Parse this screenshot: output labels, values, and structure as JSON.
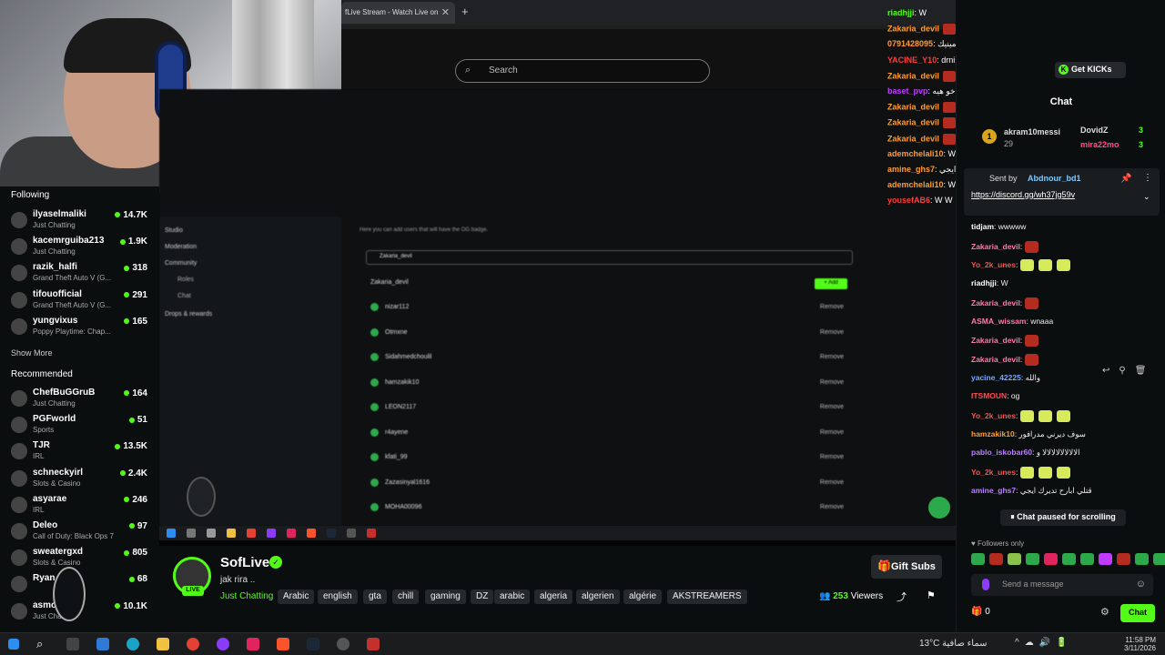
{
  "browser": {
    "tab_title": "fLive Stream - Watch Live on",
    "new_tab": "+",
    "search_placeholder": "Search"
  },
  "inner_screen": {
    "menu": [
      "Studio",
      "Moderation",
      "Community",
      "Roles",
      "Chat",
      "Drops & rewards"
    ],
    "description": "Here you can add users that will have the OG badge.",
    "search_value": "Zakaria_devil",
    "search_result": "Zakaria_devil",
    "add_label": "+ Add",
    "remove_label": "Remove",
    "users": [
      "nizar112",
      "Otmxne",
      "Sidahmedchoulil",
      "hamzakik10",
      "LEON2117",
      "r4ayene",
      "kfati_99",
      "Zazasinyal1616",
      "MOHA00096"
    ]
  },
  "overlay_chat": [
    {
      "user": "riadhjji",
      "text": ": W",
      "color": "#53fc18"
    },
    {
      "user": "Zakaria_devil",
      "text": "",
      "color": "#ff9b2f"
    },
    {
      "user": "0791428095",
      "text": ": دبرني انا الله يحفظك مينيك",
      "color": "#ff9b2f"
    },
    {
      "user": "YACINE_Y10",
      "text": ": drni ana vip",
      "color": "#ff3b3b"
    },
    {
      "user": "Zakaria_devil",
      "text": "",
      "color": "#ff9b2f"
    },
    {
      "user": "baset_pvp",
      "text": ": انا دايمن عندك خو هيه",
      "color": "#c13bff"
    },
    {
      "user": "Zakaria_devil",
      "text": "",
      "color": "#ff9b2f"
    },
    {
      "user": "Zakaria_devil",
      "text": "",
      "color": "#ff9b2f"
    },
    {
      "user": "Zakaria_devil",
      "text": "",
      "color": "#ff9b2f"
    },
    {
      "user": "ademchelali10",
      "text": ": W W W W W W W",
      "color": "#ff9b2f"
    },
    {
      "user": "amine_ghs7",
      "text": ": قتلي ابارح تديرك ايجي",
      "color": "#ff9b2f"
    },
    {
      "user": "ademchelali10",
      "text": ": W",
      "color": "#ff9b2f"
    },
    {
      "user": "yousefAB6",
      "text": ": W W",
      "color": "#ff3b3b"
    }
  ],
  "sidebar": {
    "following_title": "Following",
    "following": [
      {
        "name": "ilyaselmaliki",
        "category": "Just Chatting",
        "viewers": "14.7K"
      },
      {
        "name": "kacemrguiba213",
        "category": "Just Chatting",
        "viewers": "1.9K"
      },
      {
        "name": "razik_halfi",
        "category": "Grand Theft Auto V (G...",
        "viewers": "318"
      },
      {
        "name": "tifouofficial",
        "category": "Grand Theft Auto V (G...",
        "viewers": "291"
      },
      {
        "name": "yungvixus",
        "category": "Poppy Playtime: Chap...",
        "viewers": "165"
      }
    ],
    "show_more": "Show More",
    "recommended_title": "Recommended",
    "recommended": [
      {
        "name": "ChefBuGGruB",
        "category": "Just Chatting",
        "viewers": "164"
      },
      {
        "name": "PGFworld",
        "category": "Sports",
        "viewers": "51"
      },
      {
        "name": "TJR",
        "category": "IRL",
        "viewers": "13.5K"
      },
      {
        "name": "schneckyirl",
        "category": "Slots & Casino",
        "viewers": "2.4K"
      },
      {
        "name": "asyarae",
        "category": "IRL",
        "viewers": "246"
      },
      {
        "name": "Deleo",
        "category": "Call of Duty: Black Ops 7",
        "viewers": "97"
      },
      {
        "name": "sweatergxd",
        "category": "Slots & Casino",
        "viewers": "805"
      },
      {
        "name": "Ryan",
        "category": "",
        "viewers": "68"
      },
      {
        "name": "asmo",
        "category": "Just Chatting",
        "viewers": "10.1K"
      }
    ]
  },
  "stream": {
    "channel": "SofLive",
    "live_label": "LIVE",
    "title": "jak rira ..",
    "category": "Just Chatting",
    "tags": [
      "Arabic",
      "english",
      "gta",
      "chill",
      "gaming",
      "DZ",
      "arabic",
      "algeria",
      "algerien",
      "algérie",
      "AKSTREAMERS"
    ],
    "gift_label": "Gift Subs",
    "viewers": "253",
    "viewers_label": "Viewers"
  },
  "chat": {
    "get_kicks": "Get KICKs",
    "header": "Chat",
    "leaderboard": [
      {
        "rank": "1",
        "name": "akram10messi",
        "amount": "29"
      },
      {
        "name": "DovidZ",
        "amount": "3"
      },
      {
        "name": "mira22mo",
        "amount": "3"
      }
    ],
    "pinned_by_label": "Sent by",
    "pinned_by": "Abdnour_bd1",
    "pinned_text": "https://discord.gg/wh37jg59v",
    "messages": [
      {
        "user": "tidjam",
        "text": ": wwwww",
        "color": "#ffffff",
        "emotes": 0
      },
      {
        "user": "Zakaria_devil",
        "text": ":",
        "color": "#ff7aa8",
        "emotes": 1
      },
      {
        "user": "Yo_2k_unes",
        "text": ":",
        "color": "#ff4f4f",
        "emotes": 3
      },
      {
        "user": "riadhjji",
        "text": ":  W",
        "color": "#ffffff",
        "emotes": 0
      },
      {
        "user": "Zakaria_devil",
        "text": ":",
        "color": "#ff7aa8",
        "emotes": 1
      },
      {
        "user": "ASMA_wissam",
        "text": ": wnaaa",
        "color": "#ff7aa8",
        "emotes": 0
      },
      {
        "user": "Zakaria_devil",
        "text": ":",
        "color": "#ff7aa8",
        "emotes": 1
      },
      {
        "user": "Zakaria_devil",
        "text": ":",
        "color": "#ff7aa8",
        "emotes": 1
      },
      {
        "user": "yacine_42225",
        "text": ": والله",
        "color": "#7aa8ff",
        "emotes": 0
      },
      {
        "user": "ITSMOUN",
        "text": ": og",
        "color": "#ff4f4f",
        "emotes": 0
      },
      {
        "user": "Yo_2k_unes",
        "text": ":",
        "color": "#ff4f4f",
        "emotes": 3
      },
      {
        "user": "hamzakik10",
        "text": ": سوف ديرني مدرافور",
        "color": "#ff9b2f",
        "emotes": 0
      },
      {
        "user": "pablo_iskobar60",
        "text": ": الالالالالالالالا و",
        "color": "#b980ff",
        "emotes": 0
      },
      {
        "user": "Yo_2k_unes",
        "text": ":",
        "color": "#ff4f4f",
        "emotes": 3
      },
      {
        "user": "amine_ghs7",
        "text": ": قتلي ابارح تديرك ايجي",
        "color": "#b980ff",
        "emotes": 0
      }
    ],
    "paused": "Chat paused for scrolling",
    "followers_only": "Followers only",
    "input_placeholder": "Send a message",
    "kicks_count": "0",
    "chat_button": "Chat"
  },
  "taskbar": {
    "weather": "13°C سماء صافية",
    "time": "11:58 PM",
    "date": "3/11/2026"
  },
  "colors": {
    "accent": "#53fc18",
    "bg": "#0b0e0f",
    "panel": "#1a1d1f"
  }
}
